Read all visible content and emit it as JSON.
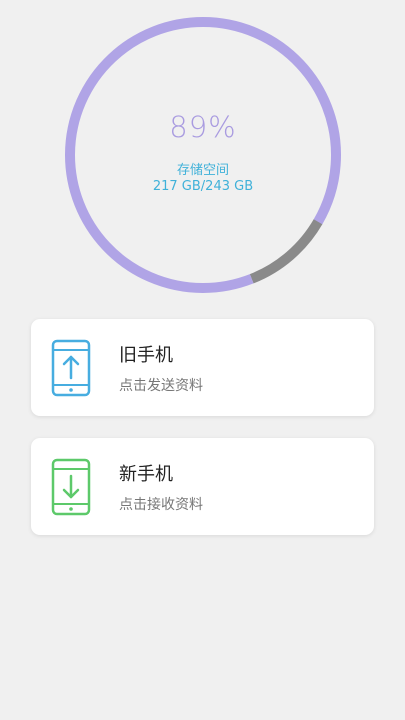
{
  "storage": {
    "percent_label": "89%",
    "title": "存储空间",
    "usage": "217 GB/243 GB",
    "used_fraction": 0.893,
    "used_color": "#b0a4e6",
    "free_color": "#8a8a8a"
  },
  "cards": {
    "old_phone": {
      "title": "旧手机",
      "subtitle": "点击发送资料",
      "icon": "phone-upload-icon",
      "color": "#47ade0"
    },
    "new_phone": {
      "title": "新手机",
      "subtitle": "点击接收资料",
      "icon": "phone-download-icon",
      "color": "#5dc96a"
    }
  }
}
